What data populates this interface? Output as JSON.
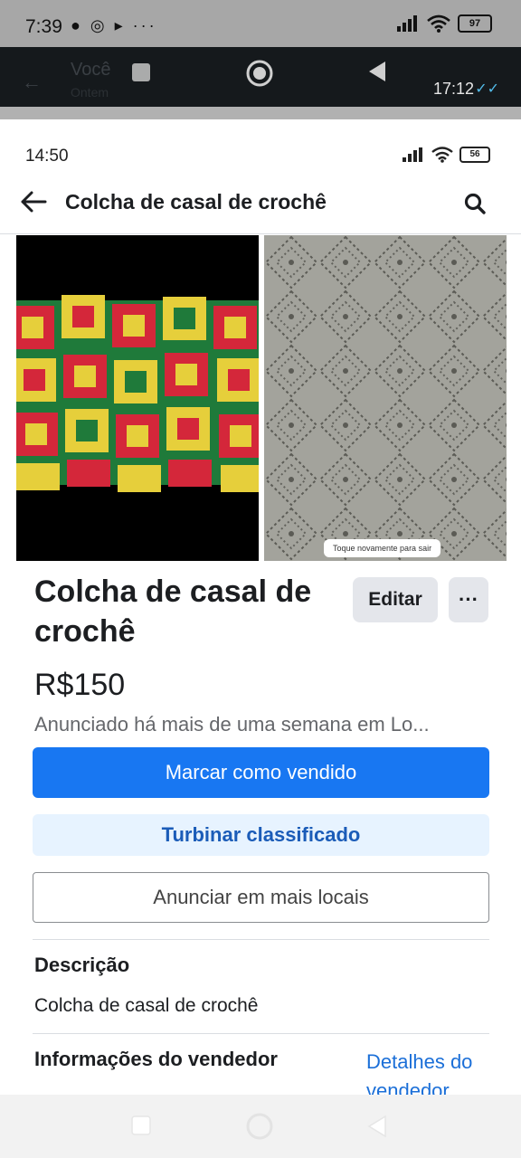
{
  "outer_status": {
    "time": "7:39",
    "notif_icons": "● ◎ ▸ ···",
    "battery": "97"
  },
  "chat_strip": {
    "ghost_name": "Você",
    "ghost_sub": "Ontem",
    "timestamp": "17:12",
    "ticks": "✓✓"
  },
  "inner_status": {
    "time": "14:50",
    "battery": "56"
  },
  "app_bar": {
    "title": "Colcha de casal de crochê"
  },
  "images": {
    "toast": "Toque novamente para sair"
  },
  "listing": {
    "title": "Colcha de casal de crochê",
    "edit_label": "Editar",
    "more_label": "···",
    "price": "R$150",
    "posted": "Anunciado há mais de uma semana em Lo...",
    "mark_sold_label": "Marcar como vendido",
    "boost_label": "Turbinar classificado",
    "list_more_label": "Anunciar em mais locais"
  },
  "description": {
    "heading": "Descrição",
    "text": "Colcha de casal de crochê"
  },
  "seller": {
    "heading": "Informações do vendedor",
    "details_link": "Detalhes do vendedor"
  },
  "colors": {
    "primary": "#1877f2",
    "boost_bg": "#e7f3ff",
    "boost_text": "#1b5cb8",
    "link": "#1b6fd8"
  }
}
